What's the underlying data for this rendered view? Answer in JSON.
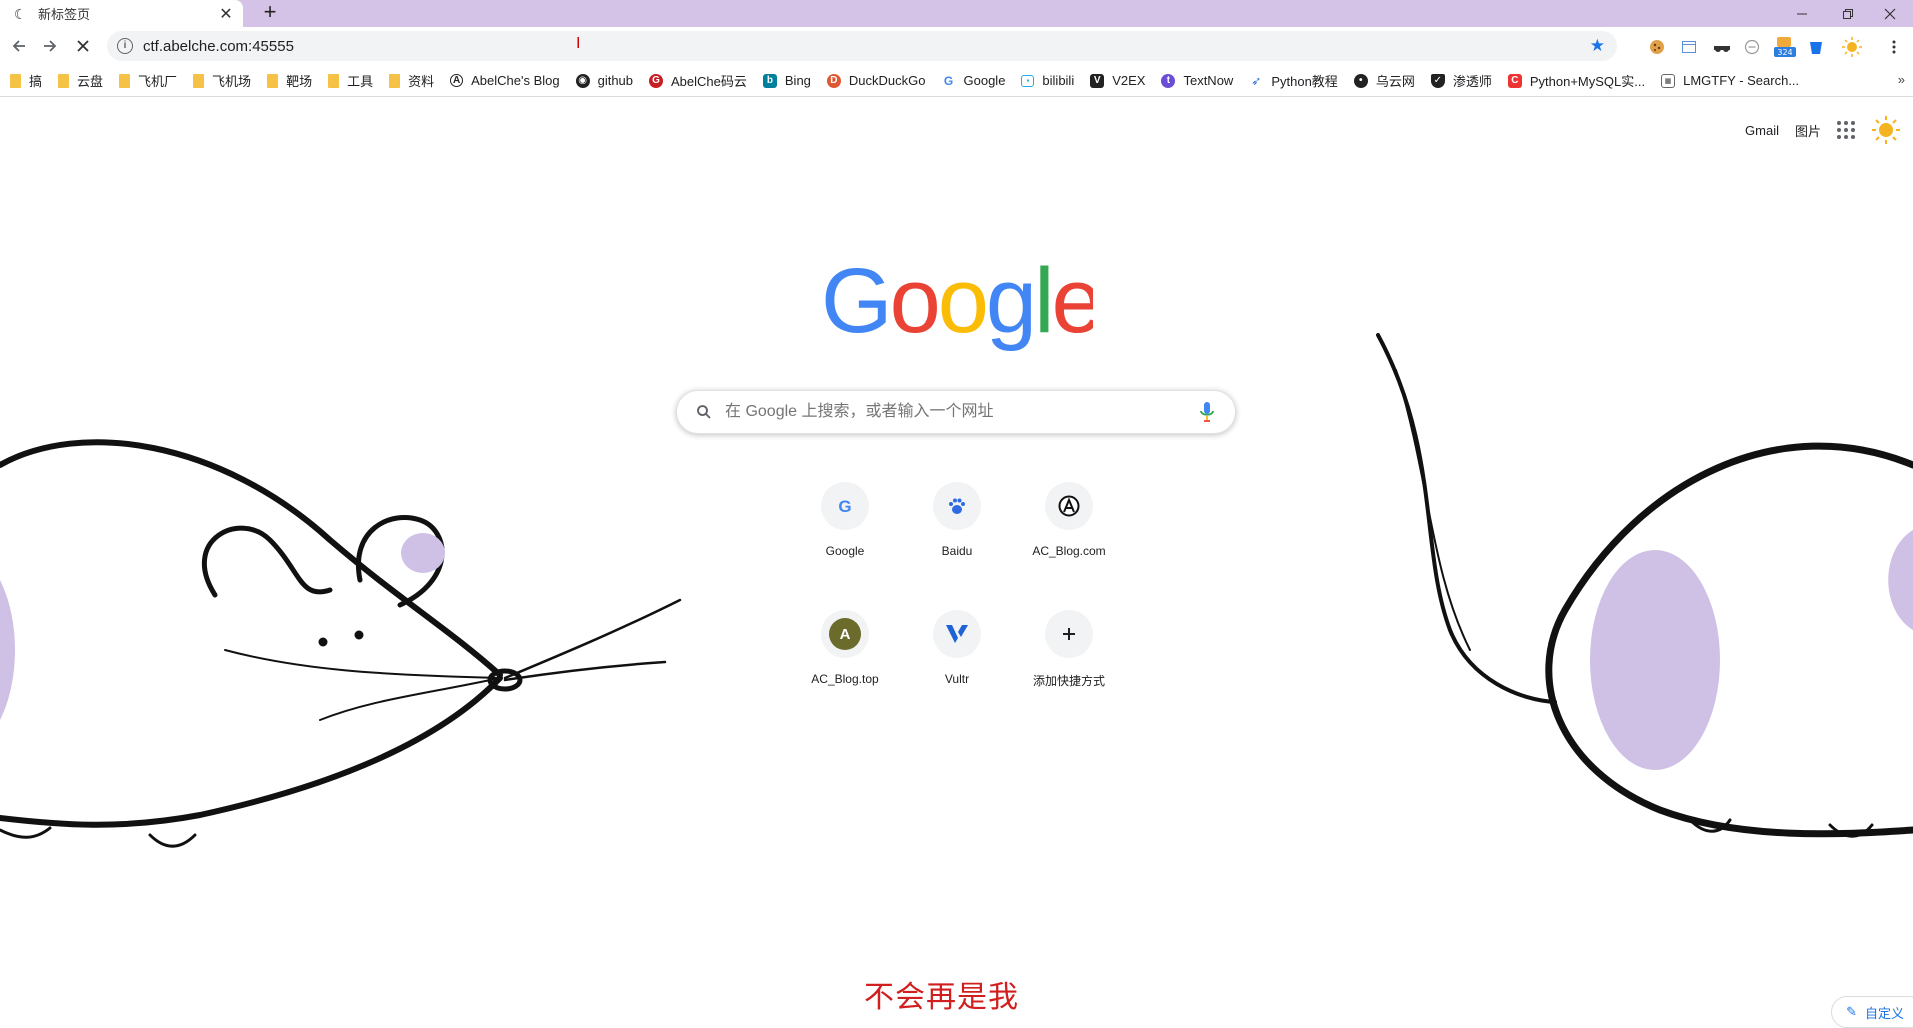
{
  "browser": {
    "tab": {
      "title": "新标签页"
    },
    "omnibox": {
      "url": "ctf.abelche.com:45555"
    },
    "bookmarks": [
      {
        "label": "搞",
        "icon": "folder-icon"
      },
      {
        "label": "云盘",
        "icon": "folder-icon"
      },
      {
        "label": "飞机厂",
        "icon": "folder-icon"
      },
      {
        "label": "飞机场",
        "icon": "folder-icon"
      },
      {
        "label": "靶场",
        "icon": "folder-icon"
      },
      {
        "label": "工具",
        "icon": "folder-icon"
      },
      {
        "label": "资料",
        "icon": "folder-icon"
      },
      {
        "label": "AbelChe's Blog",
        "icon": "abelche-blog-icon"
      },
      {
        "label": "github",
        "icon": "github-icon"
      },
      {
        "label": "AbelChe码云",
        "icon": "gitee-icon"
      },
      {
        "label": "Bing",
        "icon": "bing-icon"
      },
      {
        "label": "DuckDuckGo",
        "icon": "duckduckgo-icon"
      },
      {
        "label": "Google",
        "icon": "google-icon"
      },
      {
        "label": "bilibili",
        "icon": "bilibili-icon"
      },
      {
        "label": "V2EX",
        "icon": "v2ex-icon"
      },
      {
        "label": "TextNow",
        "icon": "textnow-icon"
      },
      {
        "label": "Python教程",
        "icon": "rocket-icon"
      },
      {
        "label": "乌云网",
        "icon": "wooyun-icon"
      },
      {
        "label": "渗透师",
        "icon": "shield-icon"
      },
      {
        "label": "Python+MySQL实...",
        "icon": "csdn-icon"
      },
      {
        "label": "LMGTFY - Search...",
        "icon": "lmgtfy-icon"
      }
    ],
    "extensions": {
      "badge": "324"
    }
  },
  "ntp": {
    "links": {
      "gmail": "Gmail",
      "images": "图片"
    },
    "search": {
      "placeholder": "在 Google 上搜索，或者输入一个网址"
    },
    "tiles": [
      {
        "label": "Google",
        "icon": "google-g-icon"
      },
      {
        "label": "Baidu",
        "icon": "baidu-paw-icon"
      },
      {
        "label": "AC_Blog.com",
        "icon": "ac-blog-icon"
      },
      {
        "label": "AC_Blog.top",
        "icon": "letter-a-icon",
        "letter": "A"
      },
      {
        "label": "Vultr",
        "icon": "vultr-icon"
      },
      {
        "label": "添加快捷方式",
        "icon": "plus-icon"
      }
    ],
    "customize": "自定义"
  },
  "overlay": {
    "subtitle": "不会再是我"
  },
  "colors": {
    "tabstrip": "#d4c3e6",
    "accent": "#1a73e8",
    "subtitle": "#d11f1f",
    "mouse_ear": "#cfc0e6"
  }
}
